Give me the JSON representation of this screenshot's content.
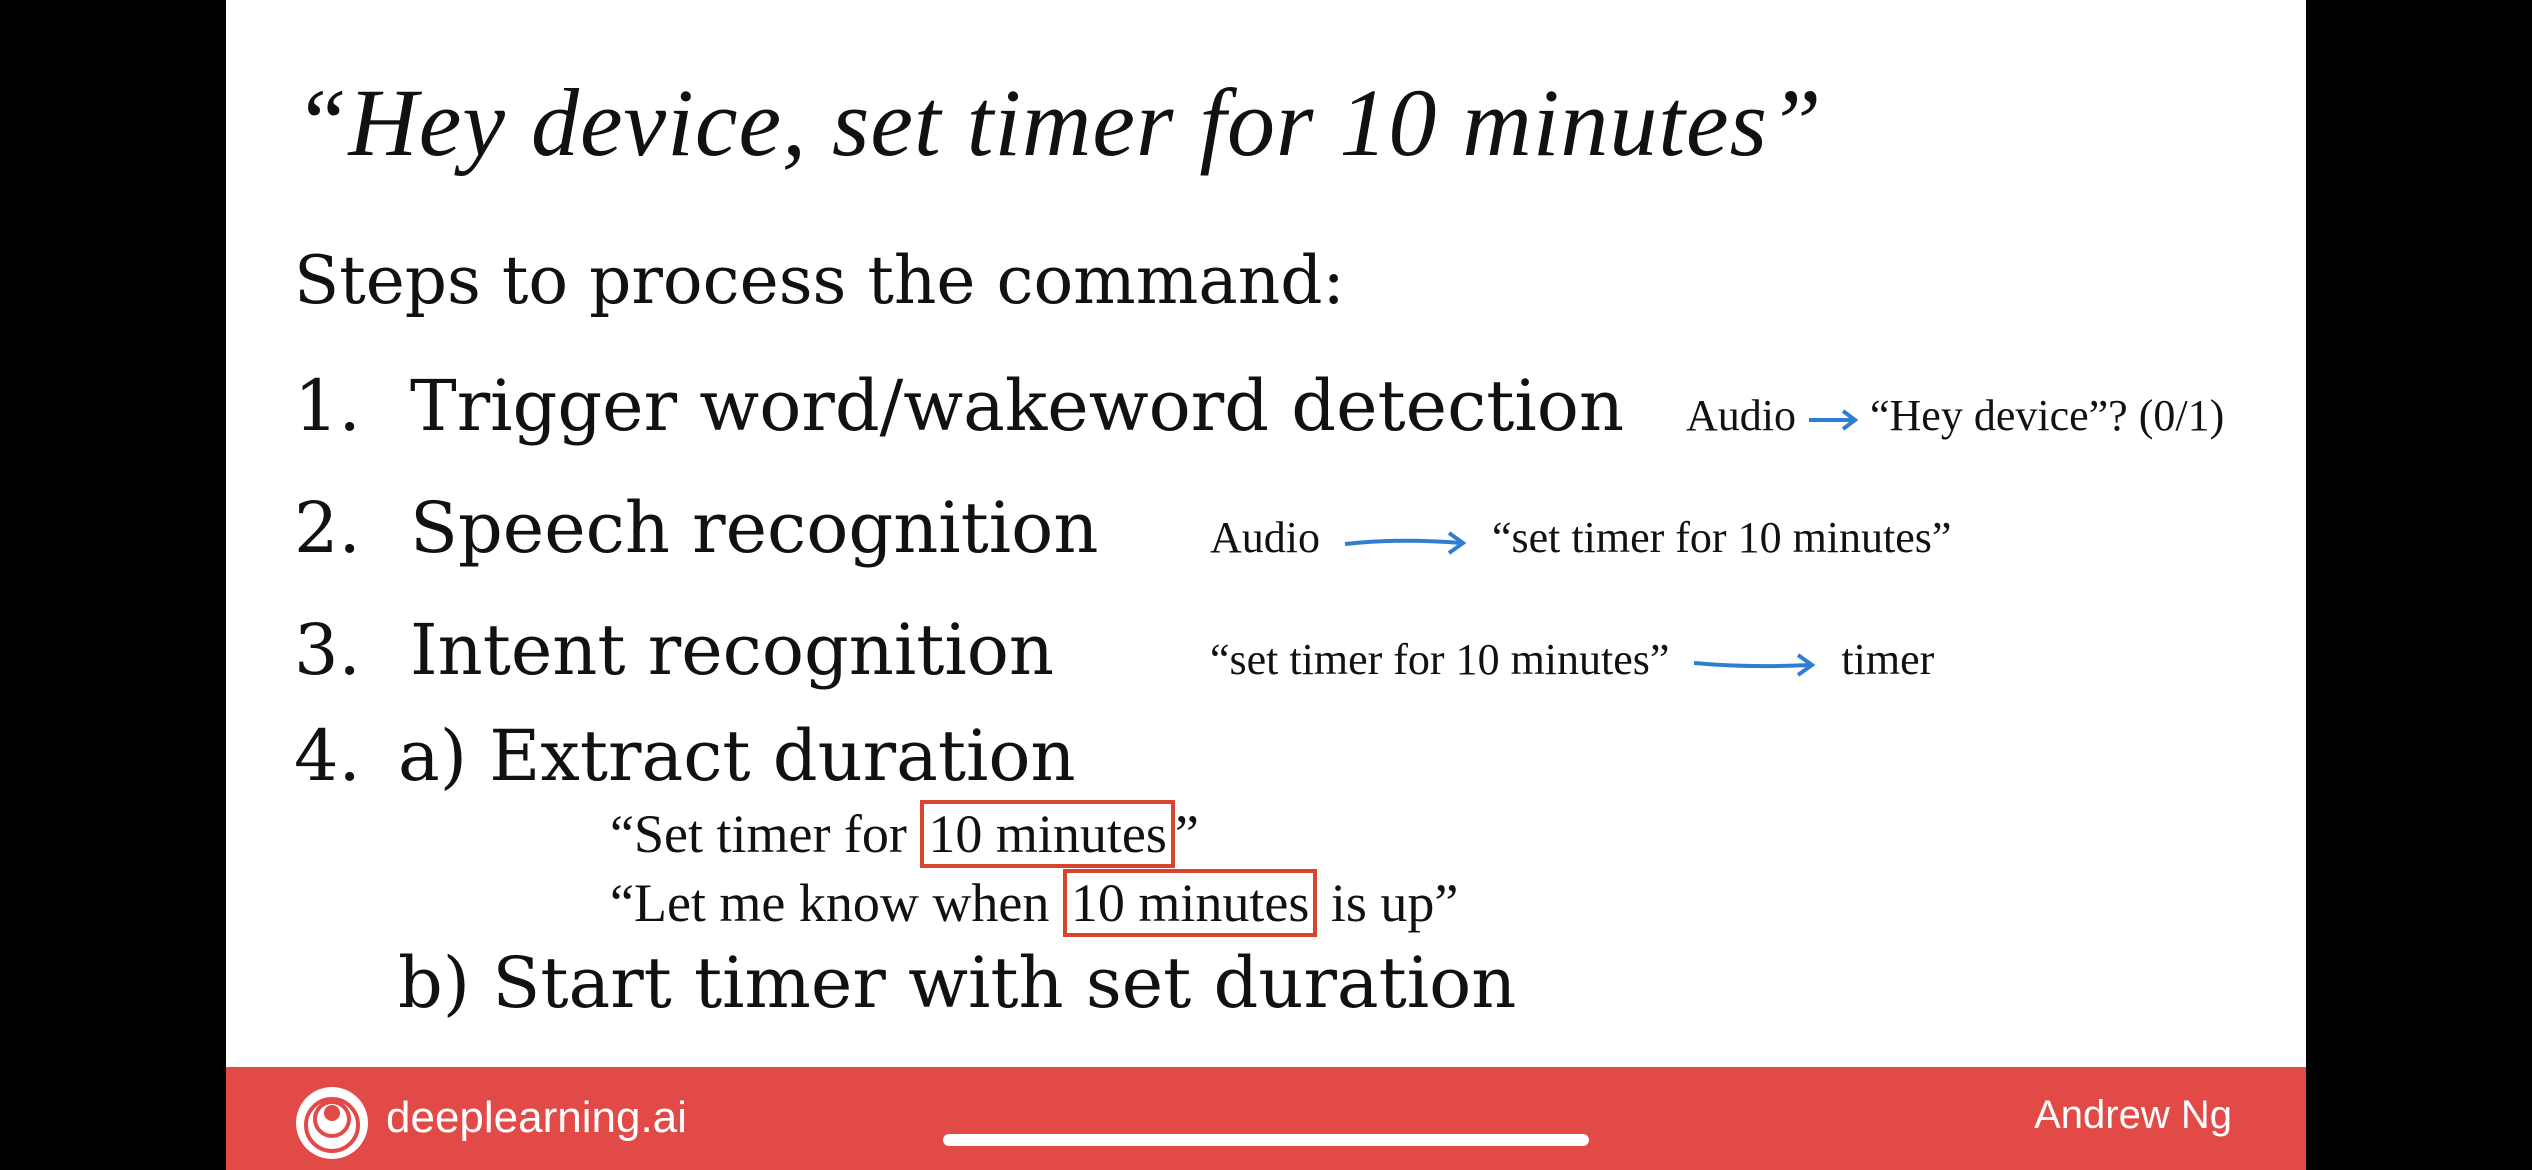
{
  "slide": {
    "title": "“Hey device, set timer for 10 minutes”",
    "steps_heading": "Steps to process the command:",
    "steps": [
      {
        "number": "1.",
        "label": "Trigger word/wakeword detection",
        "note_input": "Audio",
        "note_output": "“Hey device”? (0/1)"
      },
      {
        "number": "2.",
        "label": "Speech recognition",
        "note_input": "Audio",
        "note_output": "“set timer for 10 minutes”"
      },
      {
        "number": "3.",
        "label": "Intent recognition",
        "note_input": "“set timer for 10 minutes”",
        "note_output": "timer"
      },
      {
        "number": "4.",
        "label": "a) Extract duration"
      }
    ],
    "examples": [
      {
        "prefix": "“Set timer for ",
        "highlight": "10 minutes",
        "suffix": "”"
      },
      {
        "prefix": "“Let me know when ",
        "highlight": "10 minutes",
        "suffix": " is up”"
      }
    ],
    "substep_b": "b) Start timer with set duration",
    "accent_color": "#e24a47",
    "highlight_color": "#d9442e",
    "arrow_color": "#2f7fd1"
  },
  "footer": {
    "brand": "deeplearning.ai",
    "author": "Andrew Ng",
    "logo_icon": "deeplearning-logo-icon"
  }
}
